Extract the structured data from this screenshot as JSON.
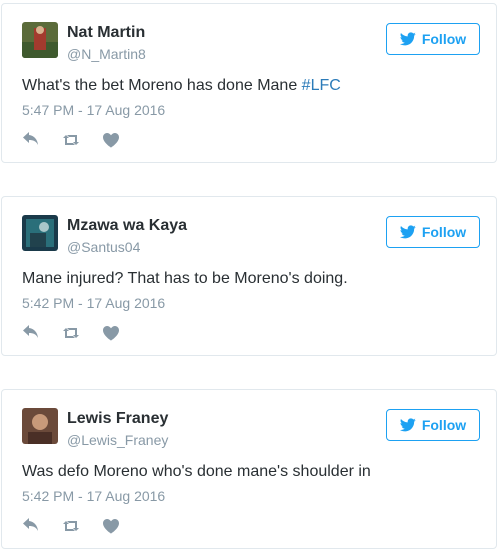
{
  "colors": {
    "brand": "#1da1f2",
    "hashtag": "#2b7bb9",
    "muted": "#8899a6",
    "text": "#292f33",
    "border": "#e1e8ed"
  },
  "follow_label": "Follow",
  "tweets": [
    {
      "name": "Nat Martin",
      "handle": "@N_Martin8",
      "text": "What's the bet Moreno has done Mane ",
      "hashtag": "#LFC",
      "time": "5:47 PM - 17 Aug 2016"
    },
    {
      "name": "Mzawa wa Kaya",
      "handle": "@Santus04",
      "text": "Mane injured? That has to be Moreno's doing.",
      "hashtag": "",
      "time": "5:42 PM - 17 Aug 2016"
    },
    {
      "name": "Lewis Franey",
      "handle": "@Lewis_Franey",
      "text": "Was defo Moreno who's done mane's shoulder in",
      "hashtag": "",
      "time": "5:42 PM - 17 Aug 2016"
    }
  ]
}
